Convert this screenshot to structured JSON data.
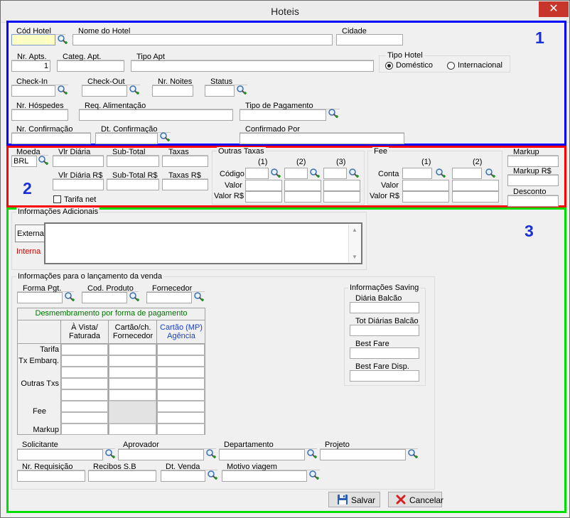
{
  "window": {
    "title": "Hoteis",
    "close": "✕"
  },
  "section_numbers": {
    "s1": "1",
    "s2": "2",
    "s3": "3"
  },
  "hotel": {
    "cod_hotel": "Cód Hotel",
    "nome_hotel": "Nome do Hotel",
    "cidade": "Cidade",
    "nr_apts": "Nr. Apts.",
    "nr_apts_value": "1",
    "categ_apt": "Categ. Apt.",
    "tipo_apt": "Tipo Apt",
    "tipo_hotel": "Tipo Hotel",
    "domestico": "Doméstico",
    "internacional": "Internacional",
    "check_in": "Check-In",
    "check_out": "Check-Out",
    "nr_noites": "Nr. Noites",
    "status": "Status",
    "nr_hospedes": "Nr. Hóspedes",
    "req_alimentacao": "Req. Alimentação",
    "tipo_pagamento": "Tipo de Pagamento",
    "nr_confirmacao": "Nr. Confirmação",
    "dt_confirmacao": "Dt. Confirmação",
    "confirmado_por": "Confirmado Por"
  },
  "valores": {
    "moeda": "Moeda",
    "moeda_value": "BRL",
    "vlr_diaria": "Vlr Diária",
    "sub_total": "Sub-Total",
    "taxas": "Taxas",
    "vlr_diaria_rs": "Vlr Diária R$",
    "sub_total_rs": "Sub-Total R$",
    "taxas_rs": "Taxas R$",
    "tarifa_net": "Tarifa net",
    "outras_taxas": "Outras Taxas",
    "col1": "(1)",
    "col2": "(2)",
    "col3": "(3)",
    "codigo": "Código",
    "valor": "Valor",
    "valor_rs": "Valor R$",
    "fee": "Fee",
    "fee_col1": "(1)",
    "fee_col2": "(2)",
    "conta": "Conta",
    "fee_valor": "Valor",
    "fee_valor_rs": "Valor R$",
    "markup": "Markup",
    "markup_rs": "Markup R$",
    "desconto": "Desconto"
  },
  "info_adicionais": {
    "title": "Informações Adicionais",
    "tab_externa": "Externa",
    "tab_interna": "Interna",
    "interna_color": "#d40000"
  },
  "venda": {
    "title": "Informações para o lançamento da venda",
    "forma_pgt": "Forma Pgt.",
    "cod_produto": "Cod. Produto",
    "fornecedor": "Fornecedor",
    "table_title": "Desmembramento por forma de pagamento",
    "col_avista": "À Vista/ Faturada",
    "col_cartao": "Cartão/ch. Fornecedor",
    "col_cartao_mp": "Cartão (MP) Agência",
    "row_tarifa": "Tarifa",
    "row_tx_embarq": "Tx Embarq.",
    "row_outras": "Outras Txs",
    "row_fee": "Fee",
    "row_markup": "Markup",
    "solicitante": "Solicitante",
    "aprovador": "Aprovador",
    "departamento": "Departamento",
    "projeto": "Projeto",
    "nr_requisicao": "Nr. Requisição",
    "recibos": "Recibos S.B",
    "dt_venda": "Dt. Venda",
    "motivo_viagem": "Motivo viagem"
  },
  "saving": {
    "title": "Informações Saving",
    "diaria_balcao": "Diária Balcão",
    "tot_diarias": "Tot Diárias Balcão",
    "best_fare": "Best Fare",
    "best_fare_disp": "Best Fare Disp."
  },
  "buttons": {
    "salvar": "Salvar",
    "cancelar": "Cancelar"
  },
  "colors": {
    "section1": "#0000ff",
    "section2": "#ff0000",
    "section3": "#00dd00",
    "table_title": "#007700",
    "cartao_mp": "#1a3fd0"
  },
  "icons": {
    "lookup": "lookup-icon",
    "save": "floppy-icon",
    "cancel": "x-icon"
  }
}
